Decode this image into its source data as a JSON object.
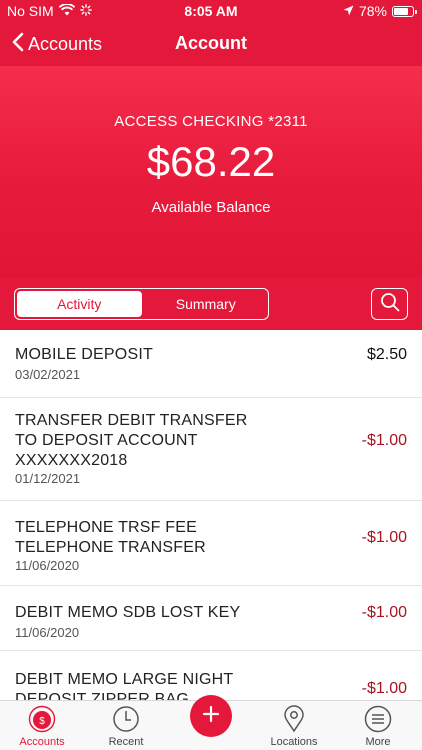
{
  "status": {
    "carrier": "No SIM",
    "time": "8:05 AM",
    "battery": "78%"
  },
  "nav": {
    "back_label": "Accounts",
    "title": "Account"
  },
  "account": {
    "name": "ACCESS CHECKING *2311",
    "balance": "$68.22",
    "balance_label": "Available Balance"
  },
  "tabs": [
    {
      "label": "Activity",
      "active": true
    },
    {
      "label": "Summary",
      "active": false
    }
  ],
  "transactions": [
    {
      "description": "MOBILE DEPOSIT",
      "date": "03/02/2021",
      "amount": "$2.50",
      "type": "credit"
    },
    {
      "description": "TRANSFER DEBIT TRANSFER TO DEPOSIT ACCOUNT XXXXXXX2018",
      "date": "01/12/2021",
      "amount": "-$1.00",
      "type": "debit"
    },
    {
      "description": "TELEPHONE TRSF FEE TELEPHONE TRANSFER",
      "date": "11/06/2020",
      "amount": "-$1.00",
      "type": "debit"
    },
    {
      "description": "DEBIT MEMO SDB LOST KEY",
      "date": "11/06/2020",
      "amount": "-$1.00",
      "type": "debit"
    },
    {
      "description": "DEBIT MEMO LARGE NIGHT DEPOSIT ZIPPER BAG",
      "date": "",
      "amount": "-$1.00",
      "type": "debit"
    }
  ],
  "tab_bar": {
    "items": [
      {
        "label": "Accounts",
        "icon": "dollar-circle-icon",
        "active": true
      },
      {
        "label": "Recent",
        "icon": "clock-icon",
        "active": false
      },
      {
        "label": "",
        "icon": "plus-icon",
        "active": false
      },
      {
        "label": "Locations",
        "icon": "location-pin-icon",
        "active": false
      },
      {
        "label": "More",
        "icon": "menu-icon",
        "active": false
      }
    ]
  },
  "colors": {
    "brand": "#e4183a",
    "debit": "#a8141f"
  }
}
